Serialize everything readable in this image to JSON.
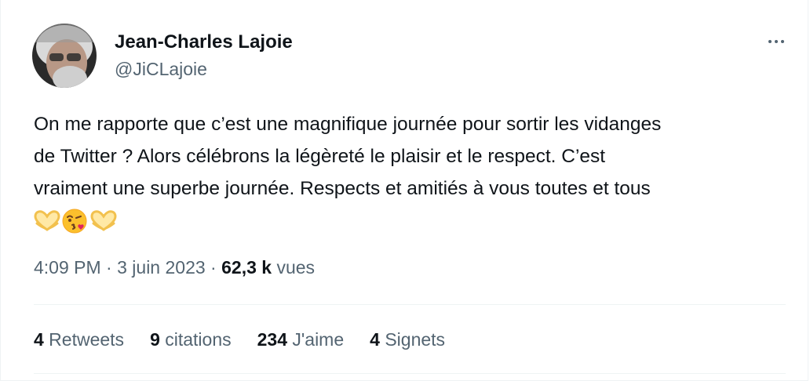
{
  "author": {
    "name": "Jean-Charles Lajoie",
    "handle": "@JiCLajoie"
  },
  "tweet": {
    "line1": "On me rapporte que c’est une magnifique journée pour sortir les vidanges",
    "line2": "de Twitter ? Alors célébrons la légèreté le plaisir et le respect. C’est",
    "line3": "vraiment une superbe journée. Respects et amitiés à vous toutes et tous",
    "emojis": [
      "heart-hands-emoji",
      "kissing-winking-emoji",
      "heart-hands-emoji"
    ]
  },
  "meta": {
    "time": "4:09 PM",
    "separator1": " · ",
    "date": "3 juin 2023",
    "separator2": " · ",
    "views_count": "62,3 k",
    "views_label": " vues"
  },
  "stats": {
    "retweets": {
      "count": "4",
      "label": " Retweets"
    },
    "quotes": {
      "count": "9",
      "label": " citations"
    },
    "likes": {
      "count": "234",
      "label": " J'aime"
    },
    "bookmarks": {
      "count": "4",
      "label": " Signets"
    }
  },
  "icons": {
    "more": "more-horizontal-icon"
  },
  "colors": {
    "primary_text": "#0f1419",
    "secondary_text": "#536471",
    "divider": "#eff3f4"
  }
}
